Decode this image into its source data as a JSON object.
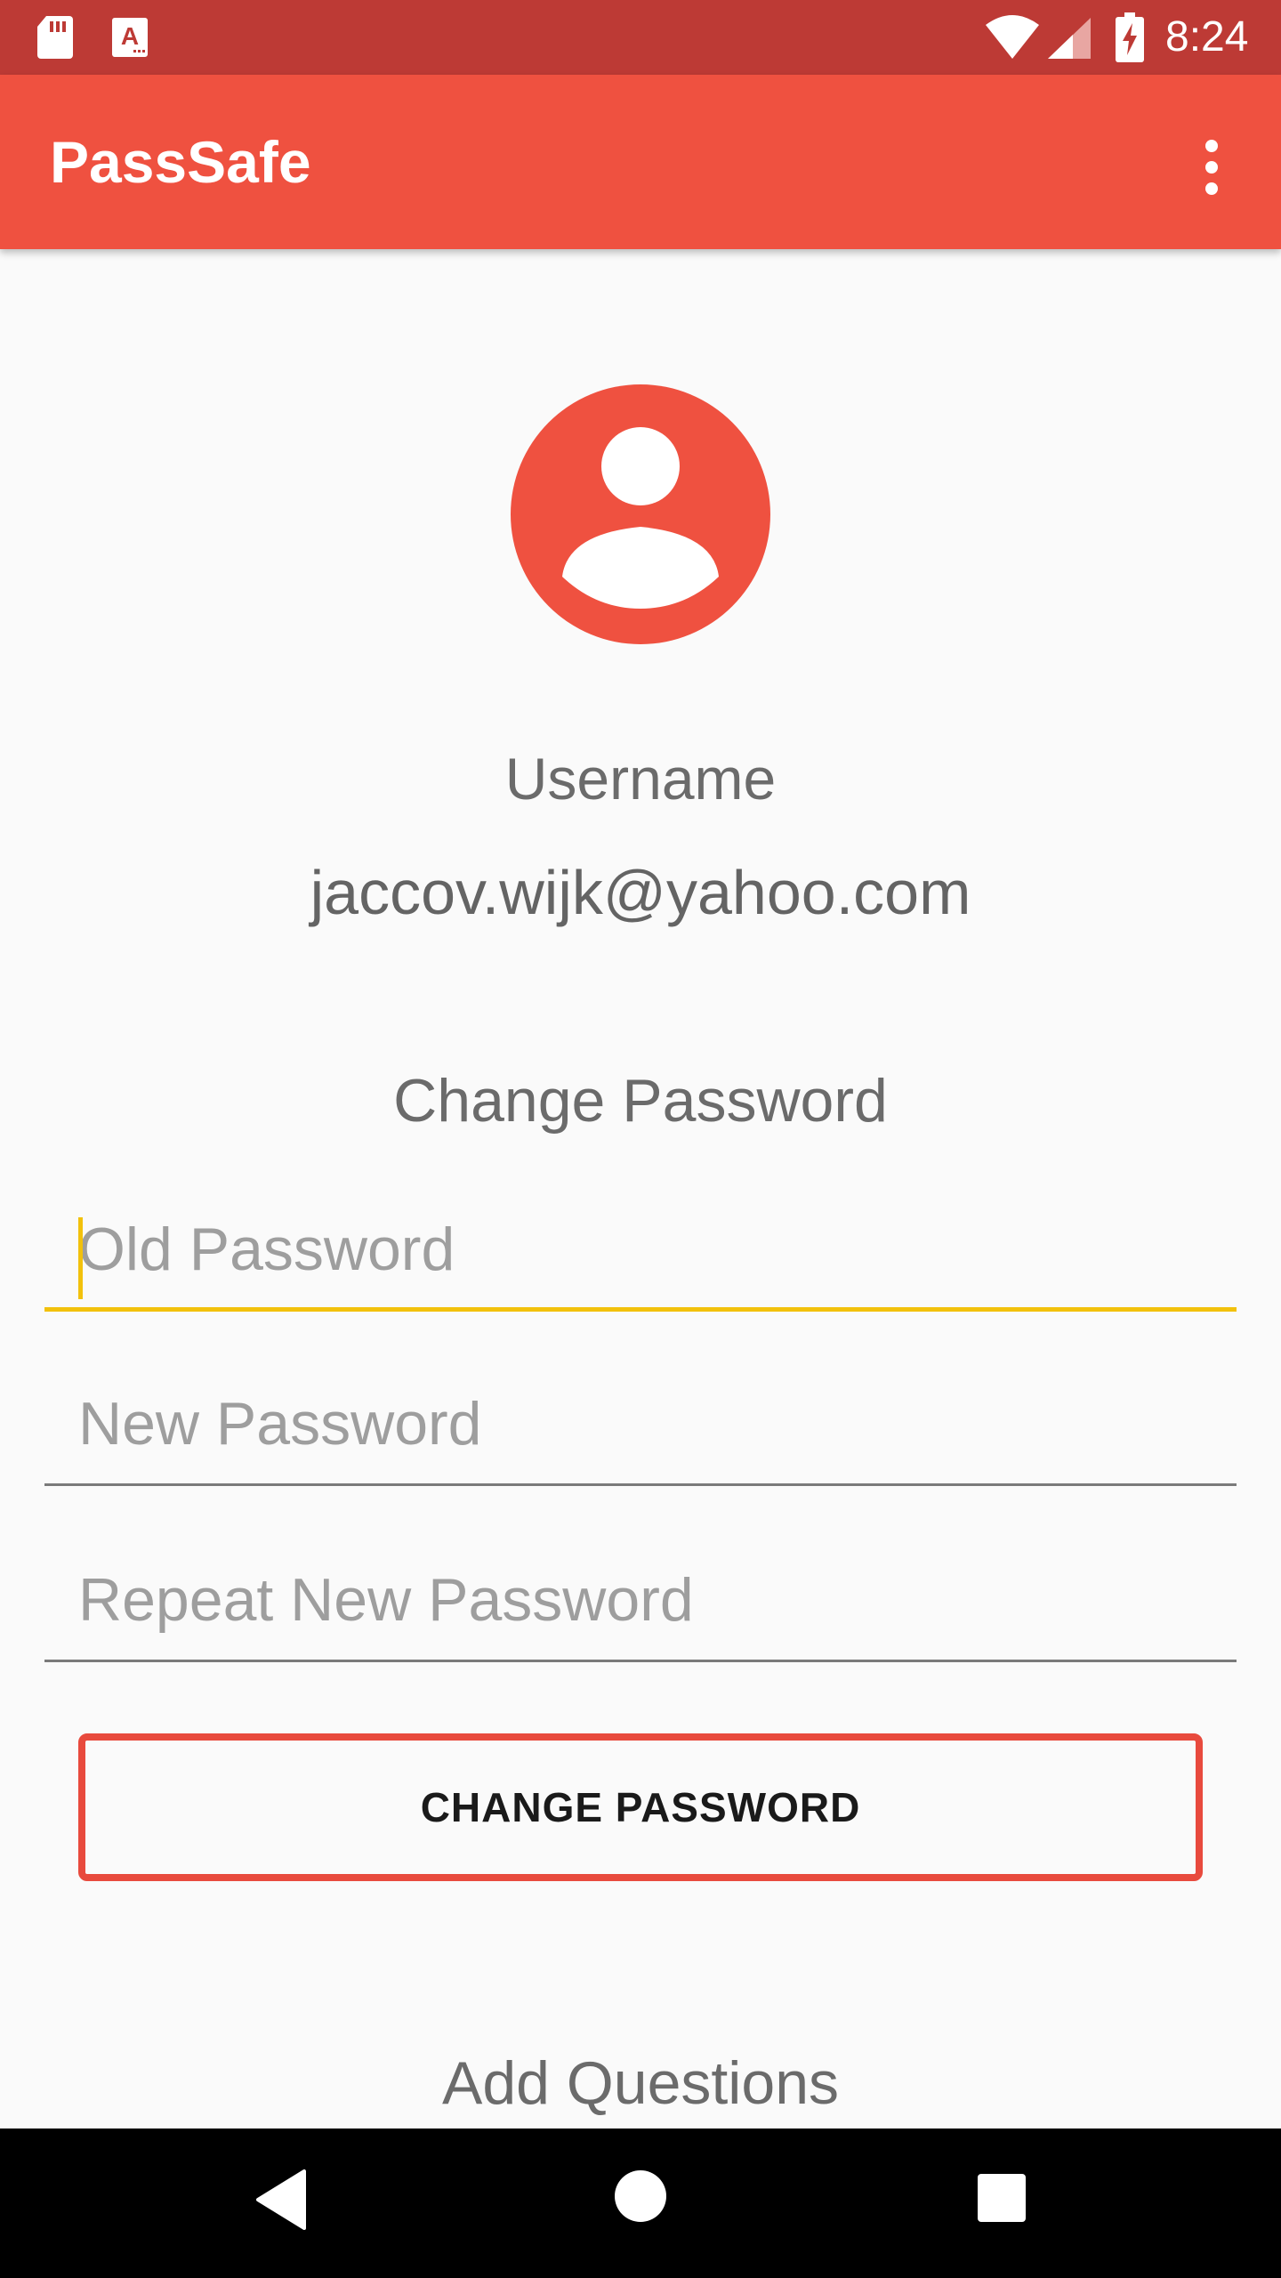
{
  "status_bar": {
    "time": "8:24",
    "icons": [
      "sd-card-icon",
      "app-a-icon",
      "wifi-icon",
      "signal-icon",
      "battery-charging-icon"
    ]
  },
  "app_bar": {
    "title": "PassSafe",
    "menu_icon": "more-vert-icon"
  },
  "profile": {
    "avatar_icon": "account-circle-icon",
    "username_label": "Username",
    "username_value": "jaccov.wijk@yahoo.com"
  },
  "change_password": {
    "title": "Change Password",
    "old_password": {
      "placeholder": "Old Password",
      "value": ""
    },
    "new_password": {
      "placeholder": "New Password",
      "value": ""
    },
    "repeat_password": {
      "placeholder": "Repeat New Password",
      "value": ""
    },
    "button_label": "CHANGE PASSWORD"
  },
  "questions": {
    "title": "Add Questions"
  },
  "nav_bar": {
    "icons": [
      "back-icon",
      "home-icon",
      "recents-icon"
    ]
  },
  "colors": {
    "status_bar": "#bd3a35",
    "app_bar": "#ef5140",
    "accent": "#f2c10c",
    "button_border": "#e84a3d",
    "background": "#fafafa"
  }
}
